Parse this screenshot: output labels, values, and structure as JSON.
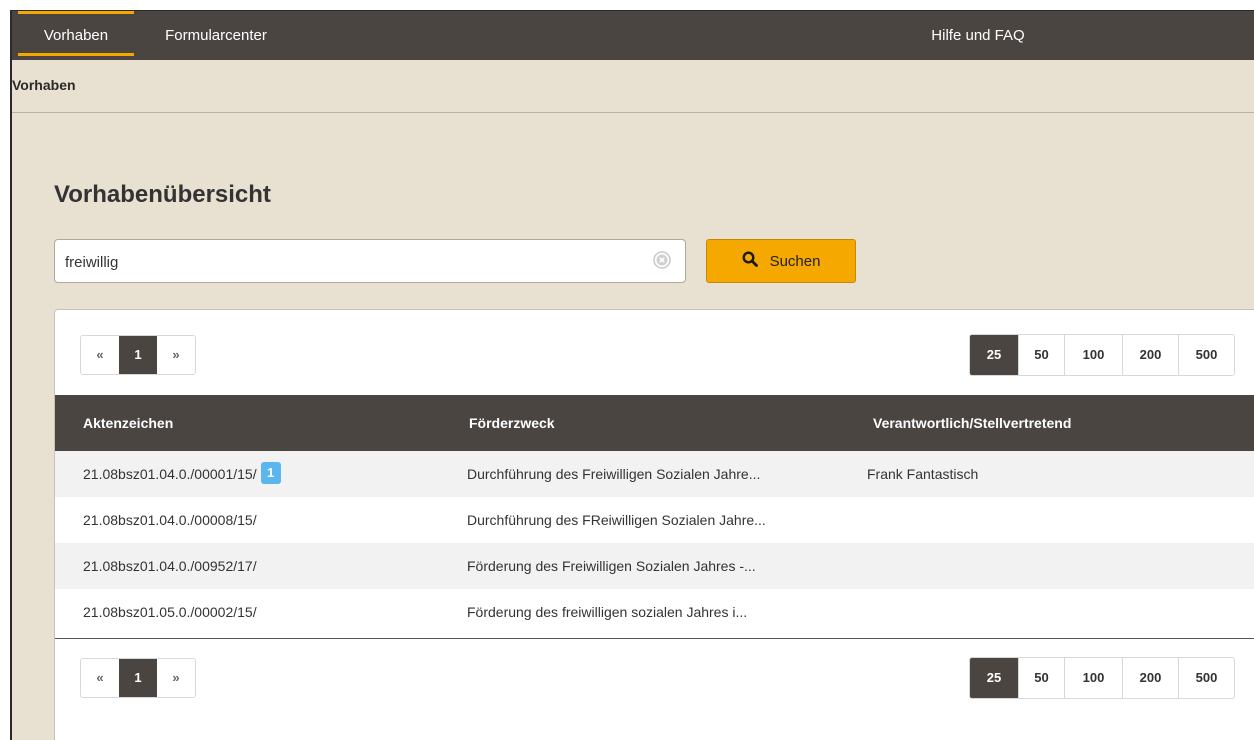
{
  "nav": {
    "tabs": [
      {
        "label": "Vorhaben",
        "active": true
      },
      {
        "label": "Formularcenter",
        "active": false
      }
    ],
    "help_label": "Hilfe und FAQ"
  },
  "breadcrumb": "Vorhaben",
  "page_title": "Vorhabenübersicht",
  "search": {
    "value": "freiwillig",
    "button_label": "Suchen"
  },
  "pagination": {
    "prev": "«",
    "current": "1",
    "next": "»"
  },
  "page_sizes": [
    "25",
    "50",
    "100",
    "200",
    "500"
  ],
  "page_size_selected": "25",
  "table": {
    "headers": [
      "Aktenzeichen",
      "Förderzweck",
      "Verantwortlich/Stellvertretend"
    ],
    "rows": [
      {
        "aktenzeichen": "21.08bsz01.04.0./00001/15/",
        "badge": "1",
        "foerderzweck": "Durchführung des Freiwilligen Sozialen Jahre...",
        "verantwortlich": "Frank Fantastisch"
      },
      {
        "aktenzeichen": "21.08bsz01.04.0./00008/15/",
        "badge": "",
        "foerderzweck": "Durchführung des FReiwilligen Sozialen Jahre...",
        "verantwortlich": ""
      },
      {
        "aktenzeichen": "21.08bsz01.04.0./00952/17/",
        "badge": "",
        "foerderzweck": "Förderung des Freiwilligen Sozialen Jahres -...",
        "verantwortlich": ""
      },
      {
        "aktenzeichen": "21.08bsz01.05.0./00002/15/",
        "badge": "",
        "foerderzweck": "Förderung des freiwilligen sozialen Jahres i...",
        "verantwortlich": ""
      }
    ]
  },
  "colors": {
    "nav_bg": "#4a4541",
    "accent": "#f5a800",
    "page_bg": "#e8e0d0",
    "badge": "#5bb5ee"
  }
}
